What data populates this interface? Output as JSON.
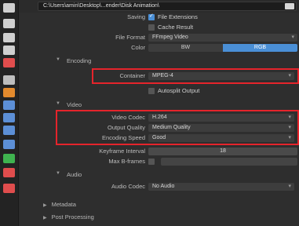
{
  "path": {
    "value": "C:\\Users\\amin\\Desktop\\...ender\\Disk Animation\\"
  },
  "toolbar_icons": [
    {
      "name": "render-icon",
      "color": "#cfcfcf"
    },
    {
      "name": "output-icon",
      "color": "#cfcfcf"
    },
    {
      "name": "view-layer-icon",
      "color": "#cfcfcf"
    },
    {
      "name": "scene-icon",
      "color": "#cfcfcf"
    },
    {
      "name": "world-icon",
      "color": "#e04d4d"
    },
    {
      "name": "collection-icon",
      "color": "#bdbdbd"
    },
    {
      "name": "object-icon",
      "color": "#e38a2d"
    },
    {
      "name": "modifier-icon",
      "color": "#5c8fd6"
    },
    {
      "name": "particles-icon",
      "color": "#5c8fd6"
    },
    {
      "name": "physics-icon",
      "color": "#5c8fd6"
    },
    {
      "name": "constraints-icon",
      "color": "#5c8fd6"
    },
    {
      "name": "data-icon",
      "color": "#3fb34f"
    },
    {
      "name": "material-icon",
      "color": "#e04d4d"
    },
    {
      "name": "texture-icon",
      "color": "#e04d4d"
    }
  ],
  "output": {
    "saving_label": "Saving",
    "file_extensions_label": "File Extensions",
    "cache_result_label": "Cache Result",
    "file_format_label": "File Format",
    "file_format_value": "FFmpeg Video",
    "color_label": "Color",
    "color_options": [
      "BW",
      "RGB"
    ],
    "color_selected": "RGB"
  },
  "encoding": {
    "title": "Encoding",
    "container_label": "Container",
    "container_value": "MPEG-4",
    "autosplit_label": "Autosplit Output"
  },
  "video": {
    "title": "Video",
    "codec_label": "Video Codec",
    "codec_value": "H.264",
    "quality_label": "Output Quality",
    "quality_value": "Medium Quality",
    "speed_label": "Encoding Speed",
    "speed_value": "Good",
    "keyframe_label": "Keyframe Interval",
    "keyframe_value": "18",
    "max_bframes_label": "Max B-frames"
  },
  "audio": {
    "title": "Audio",
    "codec_label": "Audio Codec",
    "codec_value": "No Audio"
  },
  "bottom": {
    "metadata": "Metadata",
    "post_processing": "Post Processing"
  },
  "highlight_color": "#e5242b",
  "accent_color": "#4a8fd6"
}
